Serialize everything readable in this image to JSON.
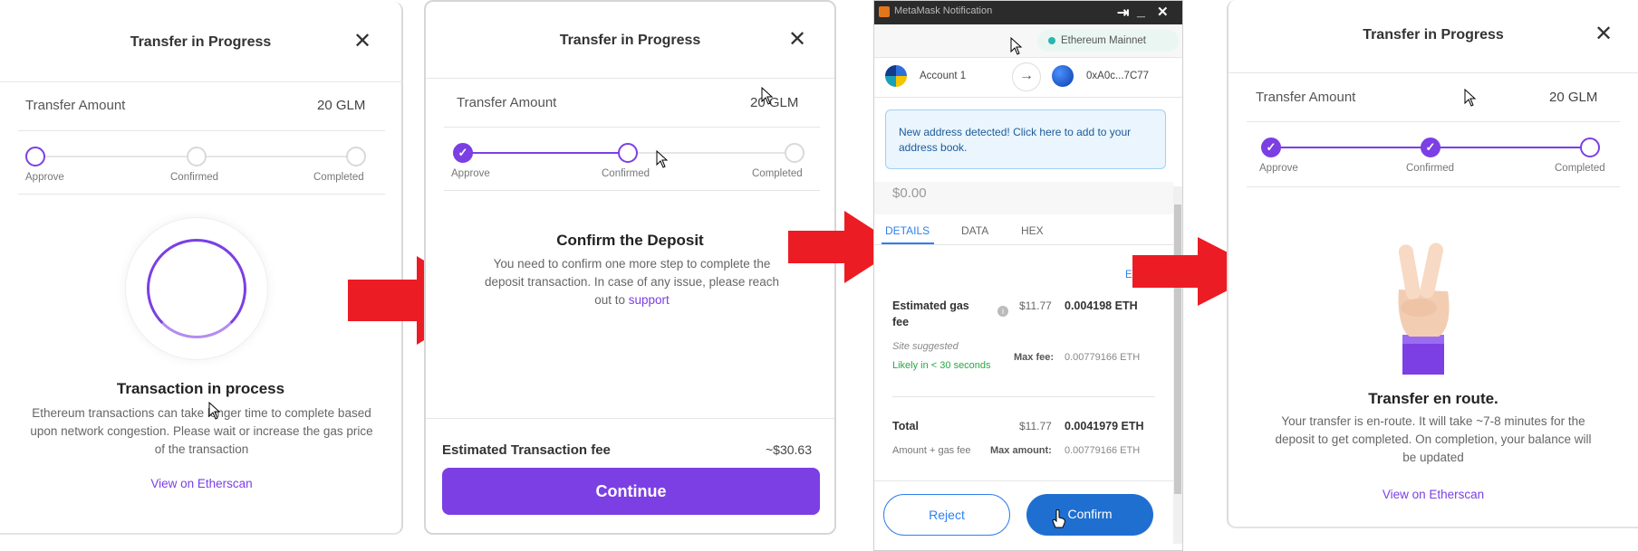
{
  "colors": {
    "accent": "#7b3fe4",
    "arrow": "#ec1c24",
    "mm_blue": "#1f6fd1"
  },
  "panel1": {
    "title": "Transfer in Progress",
    "transfer_amount_label": "Transfer Amount",
    "transfer_amount_value": "20 GLM",
    "steps": [
      "Approve",
      "Confirmed",
      "Completed"
    ],
    "status_title": "Transaction in process",
    "status_text_1": "Ethereum transactions can take longer time to complete based",
    "status_text_2": "upon network congestion. Please wait or increase the gas price",
    "status_text_3": "of the transaction",
    "view_link": "View on Etherscan"
  },
  "panel2": {
    "title": "Transfer in Progress",
    "transfer_amount_label": "Transfer Amount",
    "transfer_amount_value": "20 GLM",
    "steps": [
      "Approve",
      "Confirmed",
      "Completed"
    ],
    "confirm_title": "Confirm the Deposit",
    "confirm_text_1": "You need to confirm one more step to complete the",
    "confirm_text_2": "deposit transaction. In case of any issue, please reach",
    "confirm_text_3": "out to",
    "support_link": "support",
    "fee_label": "Estimated Transaction fee",
    "fee_value": "~$30.63",
    "continue_label": "Continue"
  },
  "metamask": {
    "window_title": "MetaMask Notification",
    "network": "Ethereum Mainnet",
    "account_from": "Account 1",
    "account_to": "0xA0c...7C77",
    "notice": "New address detected! Click here to add to your address book.",
    "amount": "$0.00",
    "tabs": [
      "DETAILS",
      "DATA",
      "HEX"
    ],
    "edit_link": "EDIT",
    "gas_label_1": "Estimated gas",
    "gas_label_2": "fee",
    "gas_usd": "$11.77",
    "gas_eth": "0.004198 ETH",
    "site_suggested": "Site suggested",
    "likely": "Likely in < 30 seconds",
    "max_fee_label": "Max fee:",
    "max_fee_value": "0.00779166 ETH",
    "total_label": "Total",
    "total_usd": "$11.77",
    "total_eth": "0.0041979 ETH",
    "amount_gas_label": "Amount + gas fee",
    "max_amount_label": "Max amount:",
    "max_amount_value": "0.00779166 ETH",
    "reject_label": "Reject",
    "confirm_label": "Confirm"
  },
  "panel4": {
    "title": "Transfer in Progress",
    "transfer_amount_label": "Transfer Amount",
    "transfer_amount_value": "20 GLM",
    "steps": [
      "Approve",
      "Confirmed",
      "Completed"
    ],
    "route_title": "Transfer en route.",
    "route_text_1": "Your transfer is en-route. It will take ~7-8 minutes for the",
    "route_text_2": "deposit to get completed. On completion, your balance will",
    "route_text_3": "be updated",
    "view_link": "View on Etherscan"
  }
}
